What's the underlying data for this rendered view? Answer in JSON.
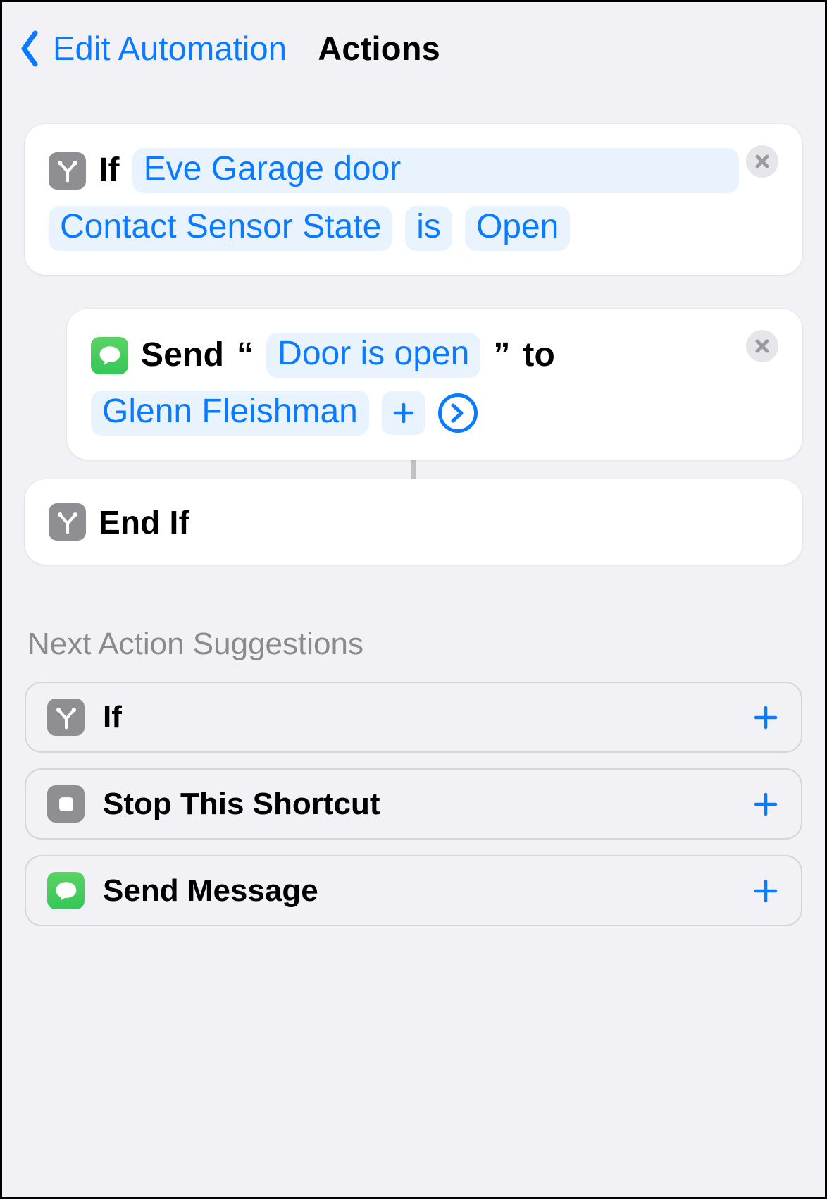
{
  "nav": {
    "back_label": "Edit Automation",
    "title": "Actions"
  },
  "actions": {
    "if_block": {
      "keyword": "If",
      "device": "Eve Garage door",
      "attribute": "Contact Sensor State",
      "operator": "is",
      "value": "Open"
    },
    "send_block": {
      "verb": "Send",
      "message": "Door is open",
      "to_word": "to",
      "recipient": "Glenn Fleishman"
    },
    "end_if": {
      "label": "End If"
    }
  },
  "suggestions": {
    "title": "Next Action Suggestions",
    "items": [
      {
        "icon": "branch",
        "label": "If"
      },
      {
        "icon": "stop",
        "label": "Stop This Shortcut"
      },
      {
        "icon": "message",
        "label": "Send Message"
      }
    ]
  }
}
